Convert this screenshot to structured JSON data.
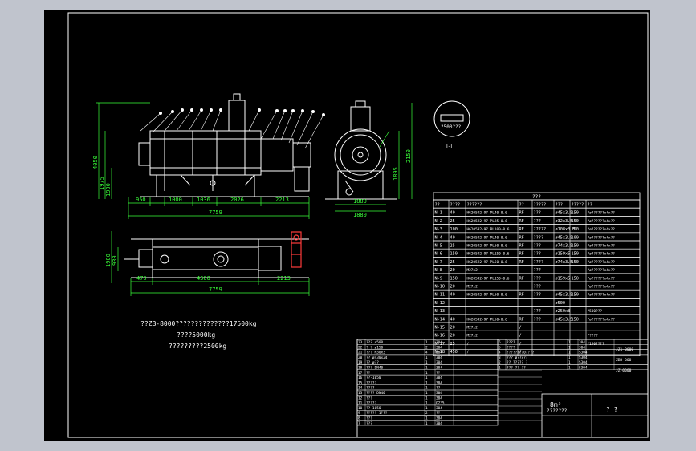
{
  "colors": {
    "background": "#000000",
    "frame": "#ffffff",
    "dimension": "#39ff39",
    "highlight": "#ff3b3b",
    "viewport": "#c0c4cd"
  },
  "notes": {
    "line1": "??ZB-8000??????????????17500kg",
    "line2": "????5000kg",
    "line3": "?????????2500kg"
  },
  "side_view_label": "Ⅰ-Ⅰ",
  "side_view_callout": "?500???",
  "dims": {
    "top_overall": "7759",
    "top_seg": [
      "950",
      "1000",
      "1036",
      "2026",
      "2213"
    ],
    "left_h": [
      "4050",
      "1975",
      "1900"
    ],
    "end_view_h": [
      "2150",
      "1895"
    ],
    "end_view_w": [
      "1880",
      "1880"
    ],
    "plan_overall": "7759",
    "plan_left": "470",
    "plan_mid": "4500",
    "plan_right": "2213",
    "plan_h": [
      "1900",
      "930"
    ]
  },
  "nozzle_table": {
    "title": "???",
    "headers": [
      "??",
      "????",
      "??????",
      "??",
      "?????",
      "???",
      "?????",
      "??"
    ],
    "rows": [
      [
        "N-1",
        "40",
        "HG20592-97 PL40-0.6",
        "RF",
        "???",
        "ø45x3.5",
        "150",
        "?ø??????x4x??"
      ],
      [
        "N-2",
        "25",
        "HG20592-97 PL25-0.6",
        "RF",
        "???",
        "ø32x3.5",
        "150",
        "?ø??????x4x??"
      ],
      [
        "N-3",
        "100",
        "HG20592-97 PL100-0.6",
        "RF",
        "?????",
        "ø108x3.5",
        "150",
        "?ø??????x4x??"
      ],
      [
        "N-4",
        "40",
        "HG20592-97 PL40-0.6",
        "RF",
        "????",
        "ø45x3.5",
        "100",
        "?ø??????x4x??"
      ],
      [
        "N-5",
        "25",
        "HG20592-97 PL50-0.6",
        "RF",
        "???",
        "ø74x3.5",
        "150",
        "?ø??????x4x??"
      ],
      [
        "N-6",
        "150",
        "HG20592-97 PL150-0.6",
        "RF",
        "???",
        "ø159x5",
        "150",
        "?ø??????x4x??"
      ],
      [
        "N-7",
        "25",
        "HG20592-97 PL50-0.6",
        "RF",
        "????",
        "ø74x3.5",
        "150",
        "?ø??????x4x??"
      ],
      [
        "N-8",
        "20",
        "M27x2",
        "",
        "???",
        "",
        "",
        "?ø??????x4x??"
      ],
      [
        "N-9",
        "150",
        "HG20592-97 PL150-0.6",
        "RF",
        "???",
        "ø159x5",
        "150",
        "?ø??????x4x??"
      ],
      [
        "N-10",
        "20",
        "M27x2",
        "",
        "???",
        "",
        "",
        "?ø??????x4x??"
      ],
      [
        "N-11",
        "40",
        "HG20592-97 PL50-0.6",
        "RF",
        "???",
        "ø45x3.5",
        "150",
        "?ø??????x4x??"
      ],
      [
        "N-12",
        "",
        "",
        "",
        "",
        "ø500",
        "",
        ""
      ],
      [
        "N-13",
        "",
        "",
        "",
        "???",
        "ø250x8",
        "",
        "?500???"
      ],
      [
        "N-14",
        "40",
        "HG20592-97 PL50-0.6",
        "RF",
        "???",
        "ø45x3.5",
        "150",
        "?ø??????x4x??"
      ],
      [
        "N-15",
        "20",
        "M27x2",
        "/",
        "",
        "",
        "",
        ""
      ],
      [
        "N-16",
        "20",
        "M27x2",
        "/",
        "",
        "",
        "",
        "?????"
      ],
      [
        "N-17",
        "25",
        "/",
        "/",
        "",
        "",
        "",
        "?150????"
      ],
      [
        "N-18",
        "450",
        "/",
        "/",
        "",
        "",
        "",
        ""
      ]
    ]
  },
  "title_block": {
    "volume": "8m³",
    "name": "???????",
    "scale_label": "? ?",
    "parts_left": [
      [
        "23",
        "??? ø500",
        "1",
        "304"
      ],
      [
        "22",
        "? ? ø150",
        "2",
        "304"
      ],
      [
        "21",
        "??? M30x3",
        "4",
        "304"
      ],
      [
        "20",
        "?? ø430x24",
        "1",
        "304"
      ],
      [
        "19",
        "?? ø??",
        "1",
        "304"
      ],
      [
        "18",
        "??? DN40",
        "1",
        "304"
      ],
      [
        "17",
        "??",
        "1",
        "??"
      ],
      [
        "16",
        "??-1050",
        "1",
        "304"
      ],
      [
        "15",
        "?????",
        "1",
        "304"
      ],
      [
        "14",
        "????",
        "1",
        "??"
      ],
      [
        "13",
        "???? DN40",
        "1",
        "304"
      ],
      [
        "12",
        "???",
        "1",
        "304"
      ],
      [
        "11",
        "?????",
        "1",
        "Q235"
      ],
      [
        "10",
        "??-1050",
        "1",
        "304"
      ],
      [
        "9",
        "????? 1???",
        "2",
        "??"
      ],
      [
        "8",
        "???",
        "1",
        "304"
      ],
      [
        "7",
        "???",
        "1",
        "304"
      ]
    ],
    "parts_right": [
      [
        "6",
        "????",
        "1",
        "304"
      ],
      [
        "5",
        "????",
        "1",
        "304"
      ],
      [
        "4",
        "????????0????",
        "1",
        "S304"
      ],
      [
        "3",
        "??? ø??x??",
        "1",
        "S304"
      ],
      [
        "2",
        "?? ????? ?",
        "1",
        "S304"
      ],
      [
        "1",
        "??? ?? ??",
        "1",
        "S304"
      ]
    ],
    "right_codes": [
      "JZ1-0000",
      "ZBD-000",
      "JZ-0000"
    ]
  }
}
